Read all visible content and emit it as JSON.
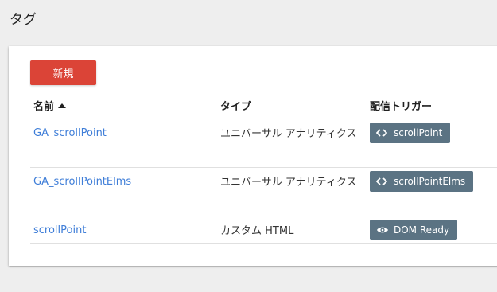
{
  "page": {
    "title": "タグ"
  },
  "toolbar": {
    "new_label": "新規"
  },
  "table": {
    "headers": {
      "name": "名前",
      "type": "タイプ",
      "trigger": "配信トリガー"
    },
    "sort": {
      "column": "name",
      "direction": "ascending"
    },
    "rows": [
      {
        "name": "GA_scrollPoint",
        "type": "ユニバーサル アナリティクス",
        "trigger": "scrollPoint",
        "trigger_icon": "code-icon"
      },
      {
        "name": "GA_scrollPointElms",
        "type": "ユニバーサル アナリティクス",
        "trigger": "scrollPointElms",
        "trigger_icon": "code-icon"
      },
      {
        "name": "scrollPoint",
        "type": "カスタム HTML",
        "trigger": "DOM Ready",
        "trigger_icon": "eye-icon"
      }
    ]
  },
  "colors": {
    "new_button": "#db4437",
    "link": "#3f7ed8",
    "trigger_chip": "#5b7383",
    "background": "#eeeeee"
  }
}
